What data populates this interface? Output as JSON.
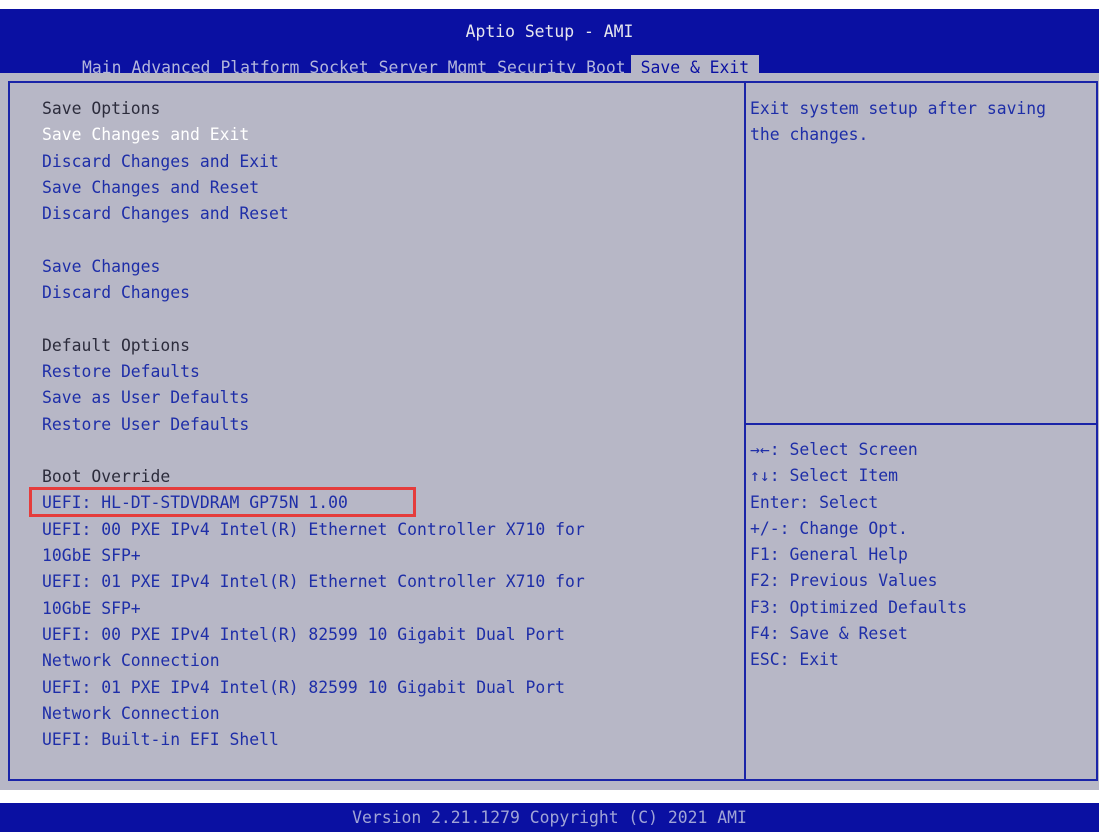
{
  "header": {
    "title": "Aptio Setup - AMI",
    "tabs": [
      "Main",
      "Advanced",
      "Platform",
      "Socket",
      "Server Mgmt",
      "Security",
      "Boot",
      "Save & Exit"
    ],
    "active_tab": "Save & Exit"
  },
  "save_options": {
    "heading": "Save Options",
    "items": [
      "Save Changes and Exit",
      "Discard Changes and Exit",
      "Save Changes and Reset",
      "Discard Changes and Reset"
    ]
  },
  "save_changes": {
    "items": [
      "Save Changes",
      "Discard Changes"
    ]
  },
  "default_options": {
    "heading": "Default Options",
    "items": [
      "Restore Defaults",
      "Save as User Defaults",
      "Restore User Defaults"
    ]
  },
  "boot_override": {
    "heading": "Boot Override",
    "lines": [
      "UEFI: HL-DT-STDVDRAM GP75N 1.00",
      "UEFI: 00 PXE IPv4 Intel(R) Ethernet Controller X710 for",
      "10GbE SFP+",
      "UEFI: 01 PXE IPv4 Intel(R) Ethernet Controller X710 for",
      "10GbE SFP+",
      "UEFI: 00 PXE IPv4 Intel(R) 82599 10 Gigabit Dual Port",
      "Network Connection",
      "UEFI: 01 PXE IPv4 Intel(R) 82599 10 Gigabit Dual Port",
      "Network Connection",
      "UEFI: Built-in EFI Shell"
    ]
  },
  "help": {
    "lines": [
      "Exit system setup after saving",
      "the changes."
    ]
  },
  "keys": [
    "→←: Select Screen",
    "↑↓: Select Item",
    "Enter: Select",
    "+/-: Change Opt.",
    "F1: General Help",
    "F2: Previous Values",
    "F3: Optimized Defaults",
    "F4: Save & Reset",
    "ESC: Exit"
  ],
  "footer": {
    "text": "Version 2.21.1279 Copyright (C) 2021 AMI"
  },
  "colors": {
    "header_bg": "#0a10a2",
    "panel_bg": "#b7b7c6",
    "option_text": "#1e2ea8",
    "selected_text": "#ffffff",
    "highlight_border": "#e53c3c"
  }
}
